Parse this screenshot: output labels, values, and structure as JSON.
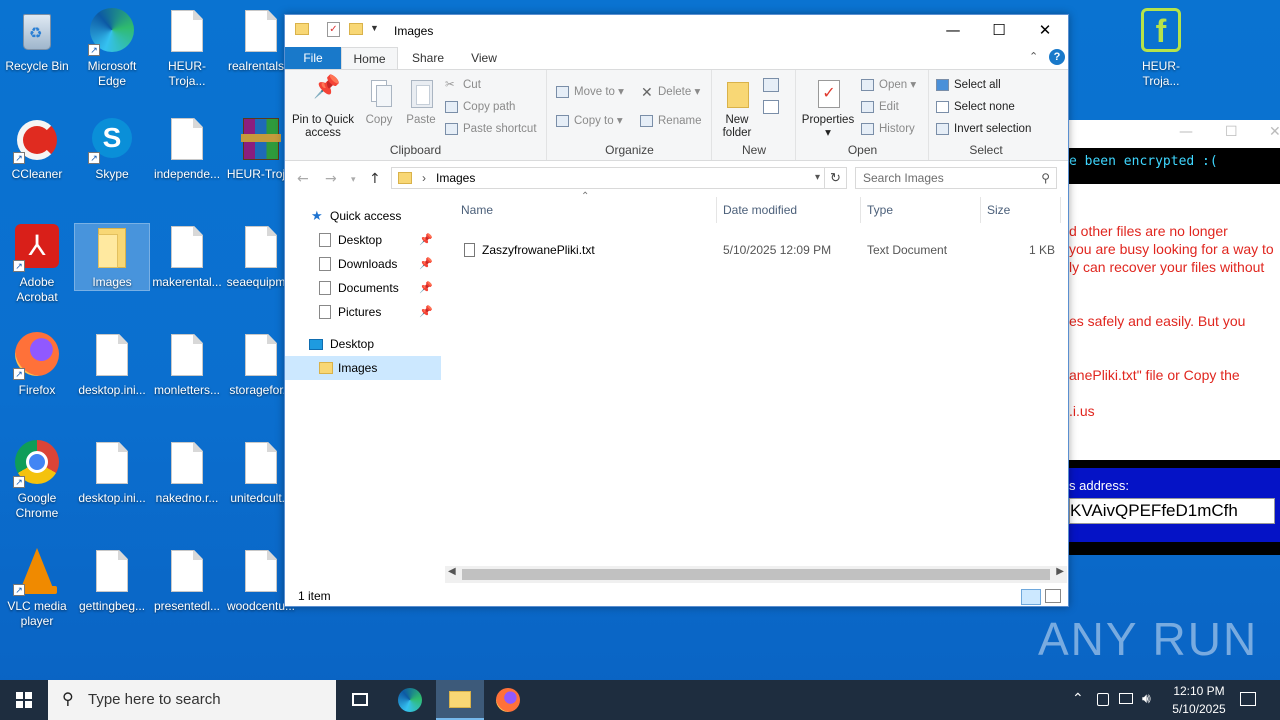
{
  "desktop": {
    "icons": [
      {
        "label": "Recycle Bin"
      },
      {
        "label": "Microsoft Edge"
      },
      {
        "label": "HEUR-Troja..."
      },
      {
        "label": "realrentals..."
      },
      {
        "label": "CCleaner"
      },
      {
        "label": "Skype"
      },
      {
        "label": "independe..."
      },
      {
        "label": "HEUR-Troj..."
      },
      {
        "label": "Adobe Acrobat"
      },
      {
        "label": "Images"
      },
      {
        "label": "makerental..."
      },
      {
        "label": "seaequipm..."
      },
      {
        "label": "Firefox"
      },
      {
        "label": "desktop.ini..."
      },
      {
        "label": "monletters..."
      },
      {
        "label": "storagefor..."
      },
      {
        "label": "Google Chrome"
      },
      {
        "label": "desktop.ini..."
      },
      {
        "label": "nakedno.r..."
      },
      {
        "label": "unitedcult..."
      },
      {
        "label": "VLC media player"
      },
      {
        "label": "gettingbeg..."
      },
      {
        "label": "presentedl..."
      },
      {
        "label": "woodcentu..."
      },
      {
        "label": "HEUR-Troja..."
      }
    ]
  },
  "ransom_window": {
    "encrypted_text": "e been encrypted :(",
    "lines": [
      "d other files are no longer",
      "you are busy looking for a way to",
      "ly can recover your files without",
      "es safely and easily. But you",
      "anePliki.txt\" file or Copy the",
      ".i.us"
    ],
    "address_label": "s address:",
    "address_value": "KVAivQPEFfeD1mCfh"
  },
  "explorer": {
    "title": "Images",
    "tabs": [
      "File",
      "Home",
      "Share",
      "View"
    ],
    "ribbon": {
      "clipboard": {
        "label": "Clipboard",
        "pin": "Pin to Quick access",
        "copy": "Copy",
        "paste": "Paste",
        "cut": "Cut",
        "copy_path": "Copy path",
        "paste_shortcut": "Paste shortcut"
      },
      "organize": {
        "label": "Organize",
        "move_to": "Move to",
        "copy_to": "Copy to",
        "delete": "Delete",
        "rename": "Rename"
      },
      "new": {
        "label": "New",
        "new_folder": "New folder"
      },
      "open": {
        "label": "Open",
        "properties": "Properties",
        "open": "Open",
        "edit": "Edit",
        "history": "History"
      },
      "select": {
        "label": "Select",
        "select_all": "Select all",
        "select_none": "Select none",
        "invert": "Invert selection"
      }
    },
    "address": {
      "path": "Images",
      "search_placeholder": "Search Images"
    },
    "nav_pane": {
      "quick_access": "Quick access",
      "items": [
        "Desktop",
        "Downloads",
        "Documents",
        "Pictures"
      ],
      "desktop": "Desktop",
      "images": "Images"
    },
    "columns": [
      "Name",
      "Date modified",
      "Type",
      "Size"
    ],
    "files": [
      {
        "name": "ZaszyfrowanePliki.txt",
        "date": "5/10/2025 12:09 PM",
        "type": "Text Document",
        "size": "1 KB"
      }
    ],
    "status": "1 item"
  },
  "taskbar": {
    "search_placeholder": "Type here to search",
    "time": "12:10 PM",
    "date": "5/10/2025"
  },
  "watermark": "ANY RUN"
}
